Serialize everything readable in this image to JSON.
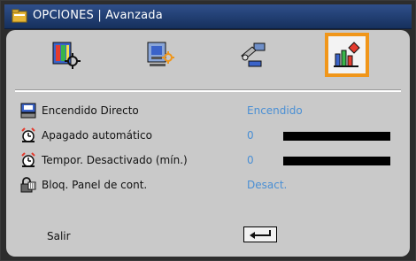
{
  "header": {
    "title": "OPCIONES | Avanzada"
  },
  "tabs": [
    {
      "icon": "image-settings-icon",
      "selected": false
    },
    {
      "icon": "display-settings-icon",
      "selected": false
    },
    {
      "icon": "setup-icon",
      "selected": false
    },
    {
      "icon": "options-icon",
      "selected": true
    }
  ],
  "menu": {
    "items": [
      {
        "label": "Encendido Directo",
        "value": "Encendido",
        "icon": "power-on-icon"
      },
      {
        "label": "Apagado automático",
        "value": "0",
        "icon": "alarm-clock-icon",
        "level": 0
      },
      {
        "label": "Tempor. Desactivado (mín.)",
        "value": "0",
        "icon": "alarm-clock-icon",
        "level": 0
      },
      {
        "label": "Bloq. Panel de cont.",
        "value": "Desact.",
        "icon": "keypad-lock-icon"
      }
    ],
    "exit_label": "Salir"
  },
  "colors": {
    "accent": "#f0961a",
    "value": "#4a8fd4",
    "title_bg": "#1e3a6e",
    "panel": "#c9c9c9"
  }
}
